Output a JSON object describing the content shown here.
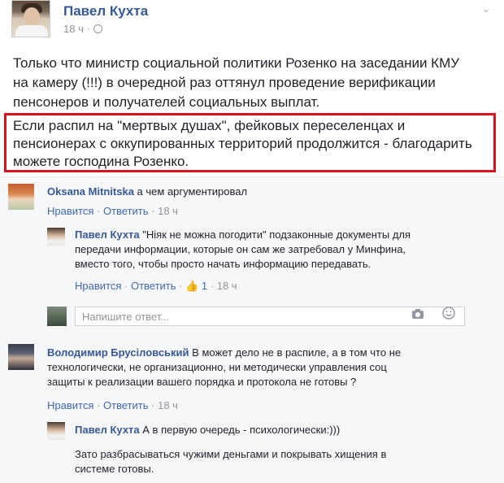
{
  "post": {
    "author": "Павел Кухта",
    "time": "18 ч",
    "paragraph_lines": [
      "Только что министр социальной политики Розенко на заседании КМУ",
      "на камеру (!!!) в очередной раз оттянул проведение верификации",
      "пенсонеров и получателей социальных выплат."
    ],
    "highlight_lines": [
      "Если распил на \"мертвых душах\", фейковых переселенцах и",
      "пенсионерах с оккупированных территорий продолжится - благодарить",
      "можете господина Розенко."
    ]
  },
  "comments": {
    "c1": {
      "author": "Oksana Mitnitska",
      "text": " а чем аргументировал",
      "like": "Нравится",
      "reply": "Ответить",
      "time": "18 ч"
    },
    "r1": {
      "author": "Павел Кухта",
      "lines": [
        " \"Ніяк не можна погодити\" подзаконные документы для",
        "передачи информации, которые он сам же затребовал у Минфина,",
        "вместо того, чтобы просто начать информацию передавать."
      ],
      "like": "Нравится",
      "reply": "Ответить",
      "likes_count": "1",
      "time": "18 ч"
    },
    "reply_box": {
      "placeholder": "Напишите ответ..."
    },
    "c2": {
      "author": "Володимир Брусіловський",
      "lines": [
        " В может дело не в распиле, а в том что не",
        "технологически, не организационно, ни методически управления соц",
        "защиты к реализации вашего порядка и протокола не готовы ?"
      ],
      "like": "Нравится",
      "reply": "Ответить",
      "time": "18 ч"
    },
    "r2": {
      "author": "Павел Кухта",
      "text": " А в первую очередь - психологически:)))",
      "lines": [
        "Зато разбрасываться чужими деньгами и покрывать хищения в",
        "системе готовы."
      ]
    }
  },
  "separator": " · ",
  "icons": {
    "globe": "globe-icon",
    "chevron": "chevron-down-icon",
    "camera": "camera-icon",
    "emoji": "emoji-icon",
    "thumb": "thumbs-up-icon"
  },
  "colors": {
    "link": "#365899",
    "highlight_border": "#d9141f",
    "comments_bg": "#f6f7f9"
  }
}
